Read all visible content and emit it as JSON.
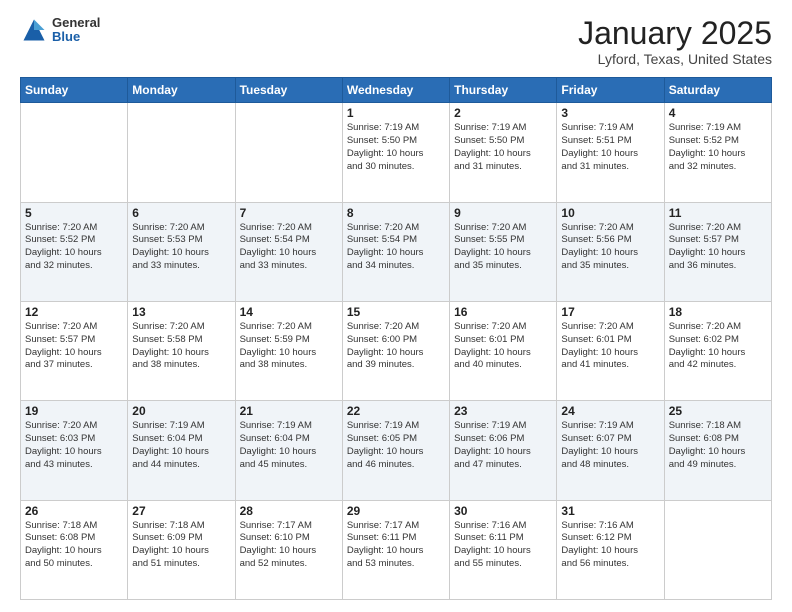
{
  "header": {
    "logo": {
      "general": "General",
      "blue": "Blue"
    },
    "title": "January 2025",
    "location": "Lyford, Texas, United States"
  },
  "weekdays": [
    "Sunday",
    "Monday",
    "Tuesday",
    "Wednesday",
    "Thursday",
    "Friday",
    "Saturday"
  ],
  "weeks": [
    [
      {
        "day": "",
        "info": ""
      },
      {
        "day": "",
        "info": ""
      },
      {
        "day": "",
        "info": ""
      },
      {
        "day": "1",
        "info": "Sunrise: 7:19 AM\nSunset: 5:50 PM\nDaylight: 10 hours\nand 30 minutes."
      },
      {
        "day": "2",
        "info": "Sunrise: 7:19 AM\nSunset: 5:50 PM\nDaylight: 10 hours\nand 31 minutes."
      },
      {
        "day": "3",
        "info": "Sunrise: 7:19 AM\nSunset: 5:51 PM\nDaylight: 10 hours\nand 31 minutes."
      },
      {
        "day": "4",
        "info": "Sunrise: 7:19 AM\nSunset: 5:52 PM\nDaylight: 10 hours\nand 32 minutes."
      }
    ],
    [
      {
        "day": "5",
        "info": "Sunrise: 7:20 AM\nSunset: 5:52 PM\nDaylight: 10 hours\nand 32 minutes."
      },
      {
        "day": "6",
        "info": "Sunrise: 7:20 AM\nSunset: 5:53 PM\nDaylight: 10 hours\nand 33 minutes."
      },
      {
        "day": "7",
        "info": "Sunrise: 7:20 AM\nSunset: 5:54 PM\nDaylight: 10 hours\nand 33 minutes."
      },
      {
        "day": "8",
        "info": "Sunrise: 7:20 AM\nSunset: 5:54 PM\nDaylight: 10 hours\nand 34 minutes."
      },
      {
        "day": "9",
        "info": "Sunrise: 7:20 AM\nSunset: 5:55 PM\nDaylight: 10 hours\nand 35 minutes."
      },
      {
        "day": "10",
        "info": "Sunrise: 7:20 AM\nSunset: 5:56 PM\nDaylight: 10 hours\nand 35 minutes."
      },
      {
        "day": "11",
        "info": "Sunrise: 7:20 AM\nSunset: 5:57 PM\nDaylight: 10 hours\nand 36 minutes."
      }
    ],
    [
      {
        "day": "12",
        "info": "Sunrise: 7:20 AM\nSunset: 5:57 PM\nDaylight: 10 hours\nand 37 minutes."
      },
      {
        "day": "13",
        "info": "Sunrise: 7:20 AM\nSunset: 5:58 PM\nDaylight: 10 hours\nand 38 minutes."
      },
      {
        "day": "14",
        "info": "Sunrise: 7:20 AM\nSunset: 5:59 PM\nDaylight: 10 hours\nand 38 minutes."
      },
      {
        "day": "15",
        "info": "Sunrise: 7:20 AM\nSunset: 6:00 PM\nDaylight: 10 hours\nand 39 minutes."
      },
      {
        "day": "16",
        "info": "Sunrise: 7:20 AM\nSunset: 6:01 PM\nDaylight: 10 hours\nand 40 minutes."
      },
      {
        "day": "17",
        "info": "Sunrise: 7:20 AM\nSunset: 6:01 PM\nDaylight: 10 hours\nand 41 minutes."
      },
      {
        "day": "18",
        "info": "Sunrise: 7:20 AM\nSunset: 6:02 PM\nDaylight: 10 hours\nand 42 minutes."
      }
    ],
    [
      {
        "day": "19",
        "info": "Sunrise: 7:20 AM\nSunset: 6:03 PM\nDaylight: 10 hours\nand 43 minutes."
      },
      {
        "day": "20",
        "info": "Sunrise: 7:19 AM\nSunset: 6:04 PM\nDaylight: 10 hours\nand 44 minutes."
      },
      {
        "day": "21",
        "info": "Sunrise: 7:19 AM\nSunset: 6:04 PM\nDaylight: 10 hours\nand 45 minutes."
      },
      {
        "day": "22",
        "info": "Sunrise: 7:19 AM\nSunset: 6:05 PM\nDaylight: 10 hours\nand 46 minutes."
      },
      {
        "day": "23",
        "info": "Sunrise: 7:19 AM\nSunset: 6:06 PM\nDaylight: 10 hours\nand 47 minutes."
      },
      {
        "day": "24",
        "info": "Sunrise: 7:19 AM\nSunset: 6:07 PM\nDaylight: 10 hours\nand 48 minutes."
      },
      {
        "day": "25",
        "info": "Sunrise: 7:18 AM\nSunset: 6:08 PM\nDaylight: 10 hours\nand 49 minutes."
      }
    ],
    [
      {
        "day": "26",
        "info": "Sunrise: 7:18 AM\nSunset: 6:08 PM\nDaylight: 10 hours\nand 50 minutes."
      },
      {
        "day": "27",
        "info": "Sunrise: 7:18 AM\nSunset: 6:09 PM\nDaylight: 10 hours\nand 51 minutes."
      },
      {
        "day": "28",
        "info": "Sunrise: 7:17 AM\nSunset: 6:10 PM\nDaylight: 10 hours\nand 52 minutes."
      },
      {
        "day": "29",
        "info": "Sunrise: 7:17 AM\nSunset: 6:11 PM\nDaylight: 10 hours\nand 53 minutes."
      },
      {
        "day": "30",
        "info": "Sunrise: 7:16 AM\nSunset: 6:11 PM\nDaylight: 10 hours\nand 55 minutes."
      },
      {
        "day": "31",
        "info": "Sunrise: 7:16 AM\nSunset: 6:12 PM\nDaylight: 10 hours\nand 56 minutes."
      },
      {
        "day": "",
        "info": ""
      }
    ]
  ]
}
